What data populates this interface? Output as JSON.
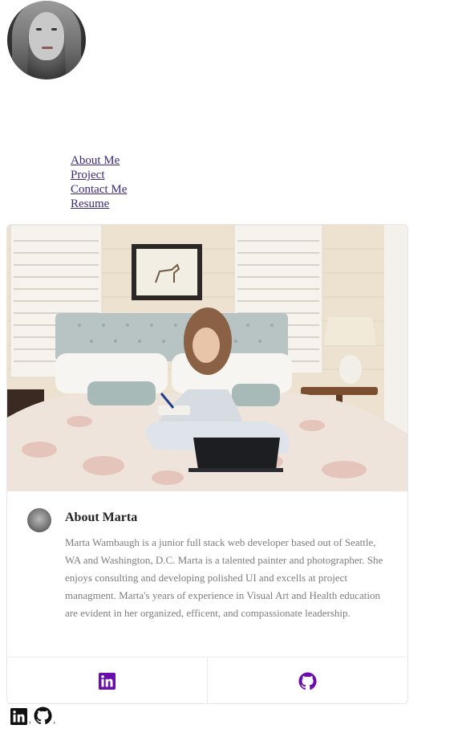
{
  "profile": {
    "avatar_icon": "profile-photo"
  },
  "nav": {
    "items": [
      {
        "label": "About Me"
      },
      {
        "label": "Project"
      },
      {
        "label": "Contact Me"
      },
      {
        "label": "Resume"
      }
    ]
  },
  "card": {
    "title": "About Marta",
    "description": "Marta Wambaugh is a junior full stack web developer based out of Seattle, WA and Washington, D.C. Marta is a talented painter and photographer. She enjoys consulting and developing polished UI and excells at project managment. Marta's years of experience in Visual Art and Health education are evident in her organized, efficent, and compassionate leadership.",
    "footer": {
      "links": [
        {
          "icon": "linkedin-icon",
          "color": "#6a0dad"
        },
        {
          "icon": "github-icon",
          "color": "#6a0dad"
        }
      ]
    }
  },
  "bottom_links": {
    "separator": ",",
    "icons": [
      "linkedin-icon",
      "github-icon"
    ]
  }
}
